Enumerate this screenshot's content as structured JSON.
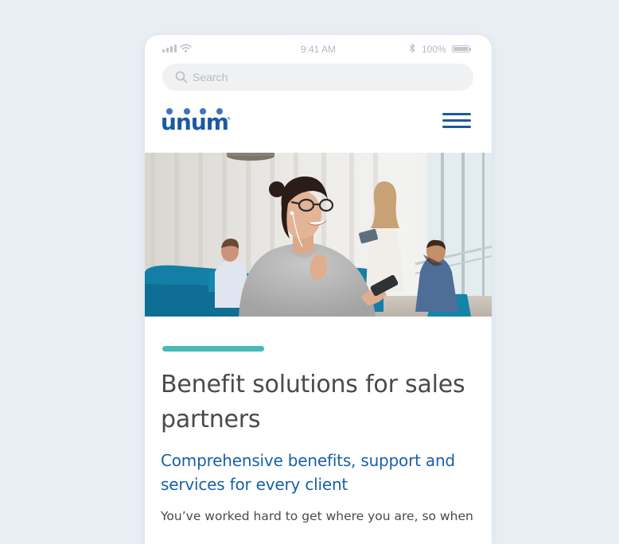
{
  "status_bar": {
    "time": "9:41 AM",
    "battery": "100%",
    "icons": [
      "signal-icon",
      "wifi-icon",
      "bluetooth-icon",
      "battery-icon"
    ]
  },
  "search": {
    "placeholder": "Search",
    "value": ""
  },
  "header": {
    "logo_text": "unum",
    "logo_mark": "®",
    "menu_icon": "hamburger-menu-icon"
  },
  "hero": {
    "image": "photo of smiling woman with glasses and earphones holding a phone in an office lounge"
  },
  "content": {
    "headline": "Benefit solutions for sales partners",
    "subhead": "Comprehensive benefits, support and services for every client",
    "body": "You’ve worked hard to get where you are, so when"
  },
  "colors": {
    "page_bg": "#e9edf4",
    "brand_blue": "#1b5aa0",
    "link_blue": "#1760a8",
    "accent_teal": "#4bb8b9",
    "headline_gray": "#4a4a4a"
  }
}
